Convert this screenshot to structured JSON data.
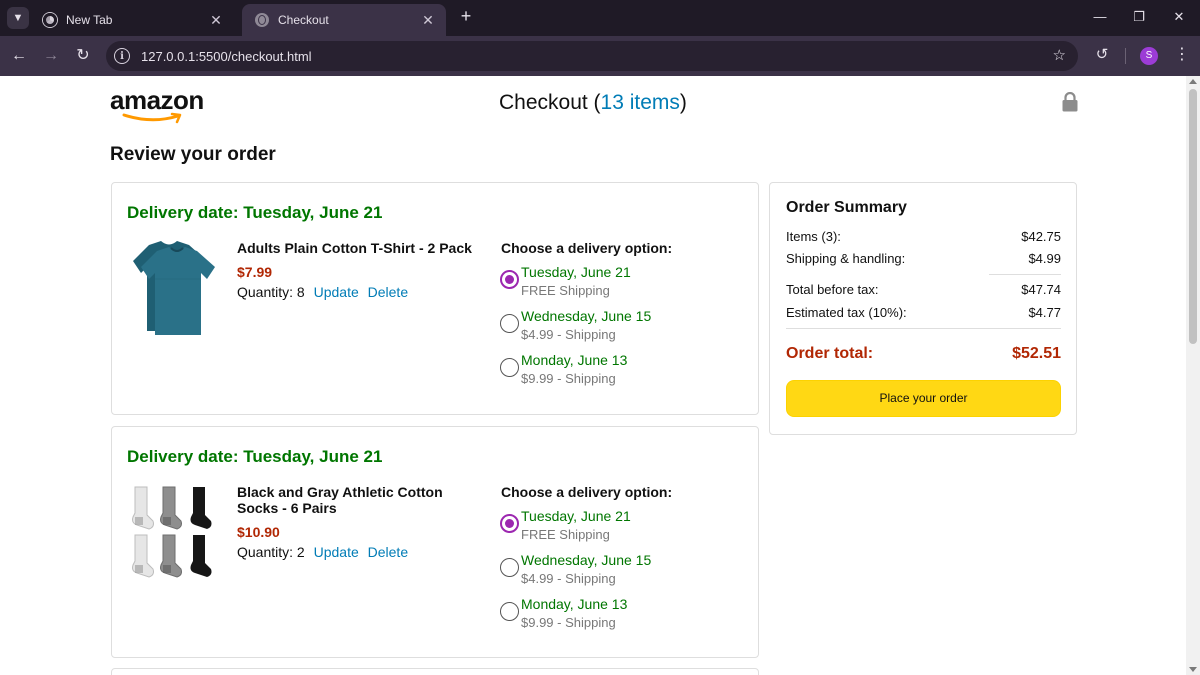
{
  "browser": {
    "tabs": [
      {
        "title": "New Tab",
        "active": false,
        "icon": "chrome-icon"
      },
      {
        "title": "Checkout",
        "active": true,
        "icon": "globe-icon"
      }
    ],
    "url": "127.0.0.1:5500/checkout.html",
    "profile_initial": "S",
    "profile_color": "#9c3cd6"
  },
  "header": {
    "logo": "amazon",
    "title_prefix": "Checkout (",
    "item_count": "13 items",
    "title_suffix": ")"
  },
  "review_heading": "Review your order",
  "orders": [
    {
      "delivery_date": "Delivery date: Tuesday, June 21",
      "product_name": "Adults Plain Cotton T-Shirt - 2 Pack",
      "price": "$7.99",
      "quantity_label": "Quantity: 8",
      "update_label": "Update",
      "delete_label": "Delete",
      "options_heading": "Choose a delivery option:",
      "options": [
        {
          "date": "Tuesday, June 21",
          "price": "FREE Shipping",
          "selected": true
        },
        {
          "date": "Wednesday, June 15",
          "price": "$4.99 - Shipping",
          "selected": false
        },
        {
          "date": "Monday, June 13",
          "price": "$9.99 - Shipping",
          "selected": false
        }
      ]
    },
    {
      "delivery_date": "Delivery date: Tuesday, June 21",
      "product_name": "Black and Gray Athletic Cotton Socks - 6 Pairs",
      "price": "$10.90",
      "quantity_label": "Quantity: 2",
      "update_label": "Update",
      "delete_label": "Delete",
      "options_heading": "Choose a delivery option:",
      "options": [
        {
          "date": "Tuesday, June 21",
          "price": "FREE Shipping",
          "selected": true
        },
        {
          "date": "Wednesday, June 15",
          "price": "$4.99 - Shipping",
          "selected": false
        },
        {
          "date": "Monday, June 13",
          "price": "$9.99 - Shipping",
          "selected": false
        }
      ]
    }
  ],
  "summary": {
    "title": "Order Summary",
    "rows": [
      {
        "label": "Items (3):",
        "amount": "$42.75"
      },
      {
        "label": "Shipping & handling:",
        "amount": "$4.99"
      },
      {
        "label": "Total before tax:",
        "amount": "$47.74"
      },
      {
        "label": "Estimated tax (10%):",
        "amount": "$4.77"
      }
    ],
    "total_label": "Order total:",
    "total_amount": "$52.51",
    "button_label": "Place your order"
  },
  "colors": {
    "delivery_green": "#007600",
    "price_red": "#b12704",
    "link_blue": "#017cb6",
    "button_yellow": "#ffd814",
    "radio_purple": "#9c27b0"
  }
}
